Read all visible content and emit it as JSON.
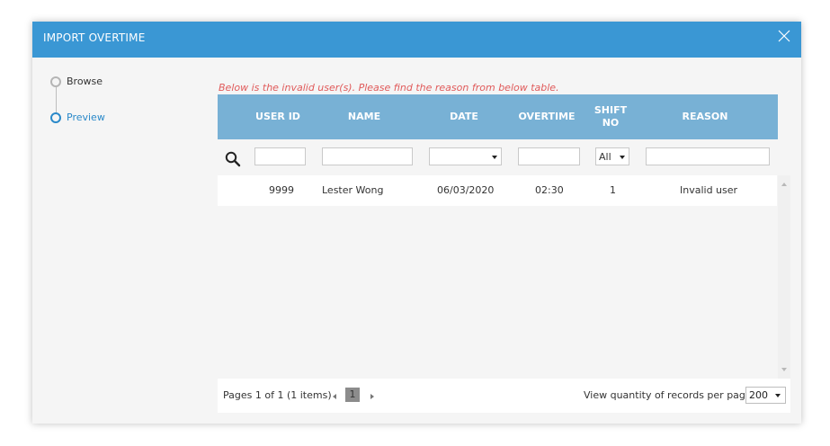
{
  "dialog": {
    "title": "IMPORT OVERTIME"
  },
  "steps": [
    {
      "label": "Browse",
      "state": "done"
    },
    {
      "label": "Preview",
      "state": "active"
    }
  ],
  "notice": "Below is the invalid user(s). Please find the reason from below table.",
  "table": {
    "columns": [
      "USER ID",
      "NAME",
      "DATE",
      "OVERTIME",
      "SHIFT NO",
      "REASON"
    ],
    "filters": {
      "shift_no_selected": "All"
    },
    "rows": [
      {
        "user_id": "9999",
        "name": "Lester Wong",
        "date": "06/03/2020",
        "overtime": "02:30",
        "shift_no": "1",
        "reason": "Invalid user"
      }
    ]
  },
  "pager": {
    "info": "Pages 1 of 1 (1 items)",
    "current_page": "1",
    "qty_label": "View quantity of records per page",
    "qty_value": "200"
  },
  "colors": {
    "header_bg": "#3a97d4",
    "table_header_bg": "#78b1d5",
    "active_step": "#2a89c9",
    "notice_text": "#e05a5a"
  },
  "icons": [
    "close-icon",
    "search-icon",
    "chevron-down-icon",
    "scroll-up-icon",
    "scroll-down-icon",
    "prev-page-icon",
    "next-page-icon"
  ]
}
